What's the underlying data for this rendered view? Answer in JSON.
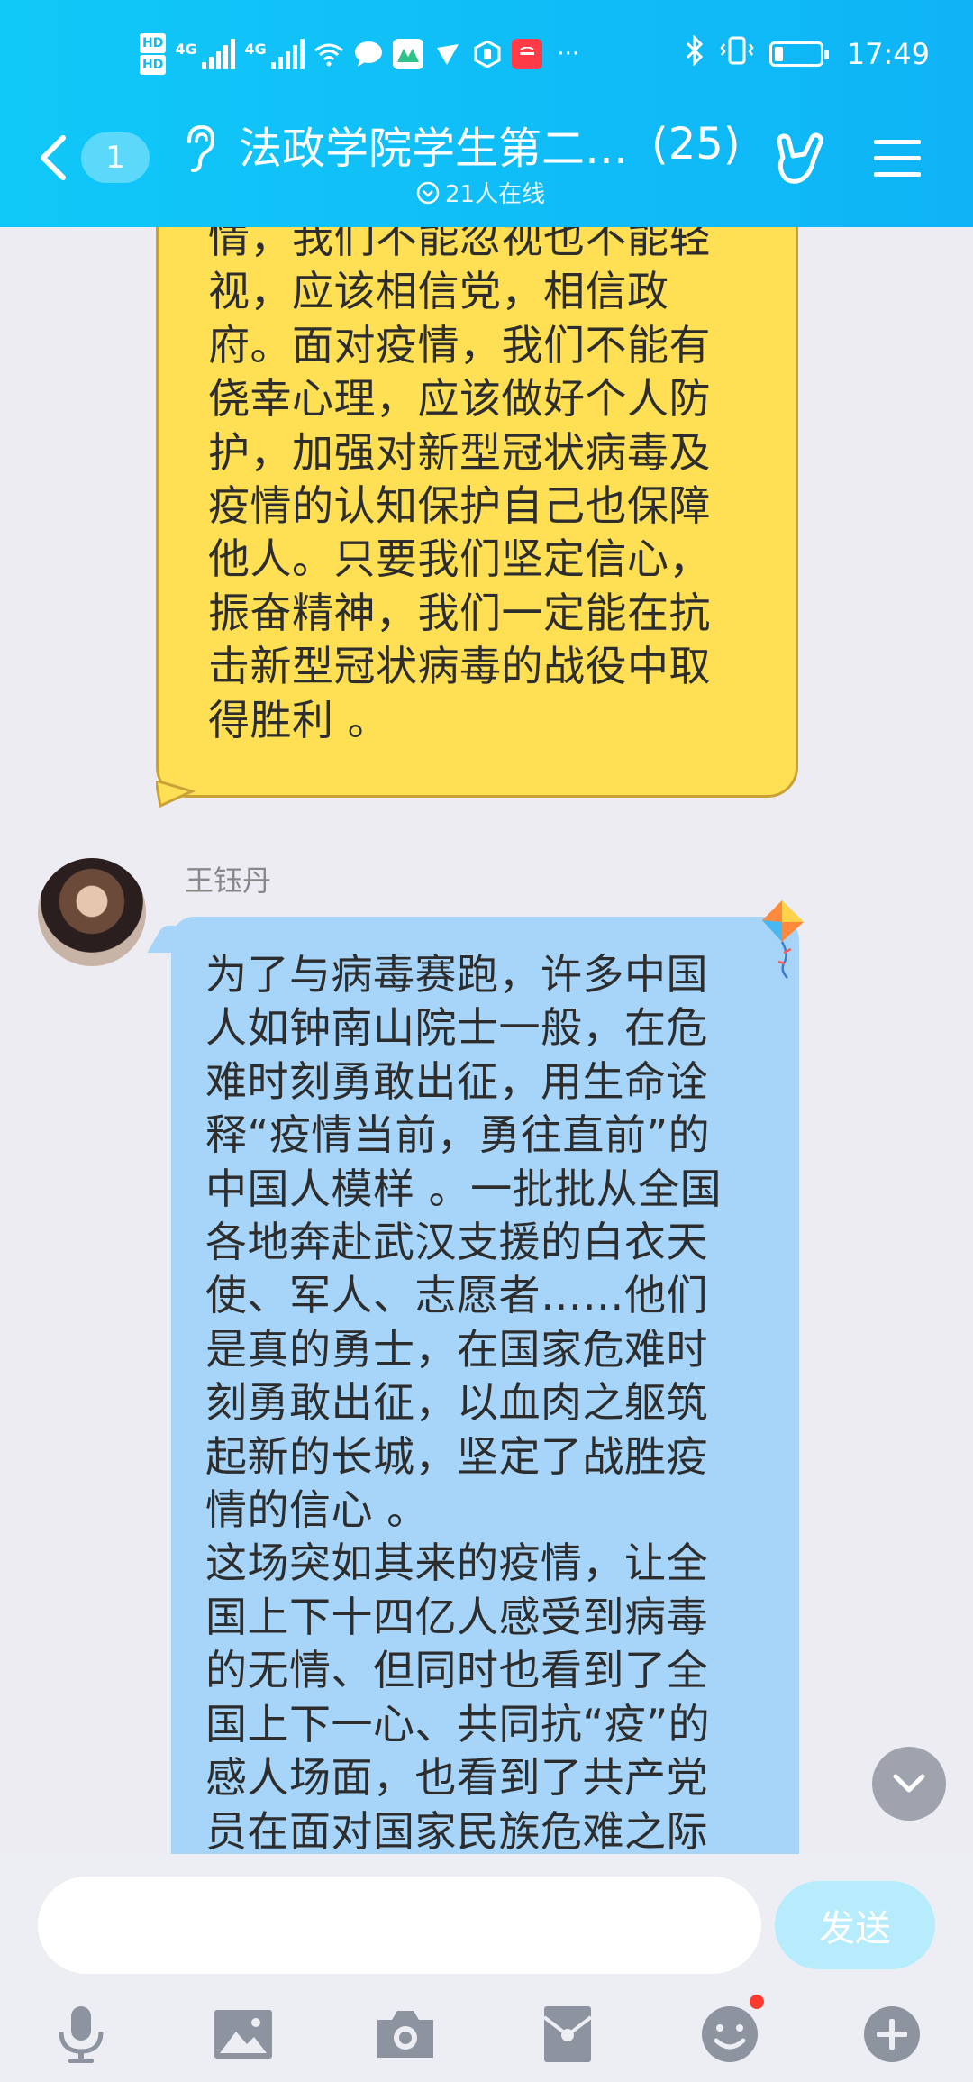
{
  "status_bar": {
    "hd1": "HD",
    "hd2": "HD",
    "sim1": "4G",
    "sim2": "4G",
    "time": "17:49",
    "battery_level": 0.2
  },
  "header": {
    "back_badge": "1",
    "title": "法政学院学生第二…",
    "member_count": "(25)",
    "online": "21人在线"
  },
  "messages": [
    {
      "type": "outgoing",
      "text": "情，我们不能忽视也不能轻\n视，应该相信党，相信政\n府。面对疫情，我们不能有\n侥幸心理，应该做好个人防\n护，加强对新型冠状病毒及\n疫情的认知保护自己也保障\n他人。只要我们坚定信心，\n振奋精神，我们一定能在抗\n击新型冠状病毒的战役中取\n得胜利 。"
    },
    {
      "type": "incoming",
      "sender": "王钰丹",
      "text": "为了与病毒赛跑，许多中国\n人如钟南山院士一般，在危\n难时刻勇敢出征，用生命诠\n释“疫情当前，勇往直前”的\n中国人模样 。一批批从全国\n各地奔赴武汉支援的白衣天\n使、军人、志愿者……他们\n是真的勇士，在国家危难时\n刻勇敢出征，以血肉之躯筑\n起新的长城，坚定了战胜疫\n情的信心 。\n这场突如其来的疫情，让全\n国上下十四亿人感受到病毒\n的无情、但同时也看到了全\n国上下一心、共同抗“疫”的\n感人场面，也看到了共产党\n员在面对国家民族危难之际\n义不容辞、身先士卒、舍小家"
    }
  ],
  "composer": {
    "placeholder": "",
    "send_label": "发送"
  },
  "toolbar_icons": [
    "microphone-icon",
    "image-icon",
    "camera-icon",
    "red-packet-icon",
    "emoji-icon",
    "plus-icon"
  ],
  "colors": {
    "header": "#10c8f8",
    "outgoing_bubble": "#ffe055",
    "incoming_bubble": "#a7d5f9",
    "send_button": "#b6ecfb"
  }
}
